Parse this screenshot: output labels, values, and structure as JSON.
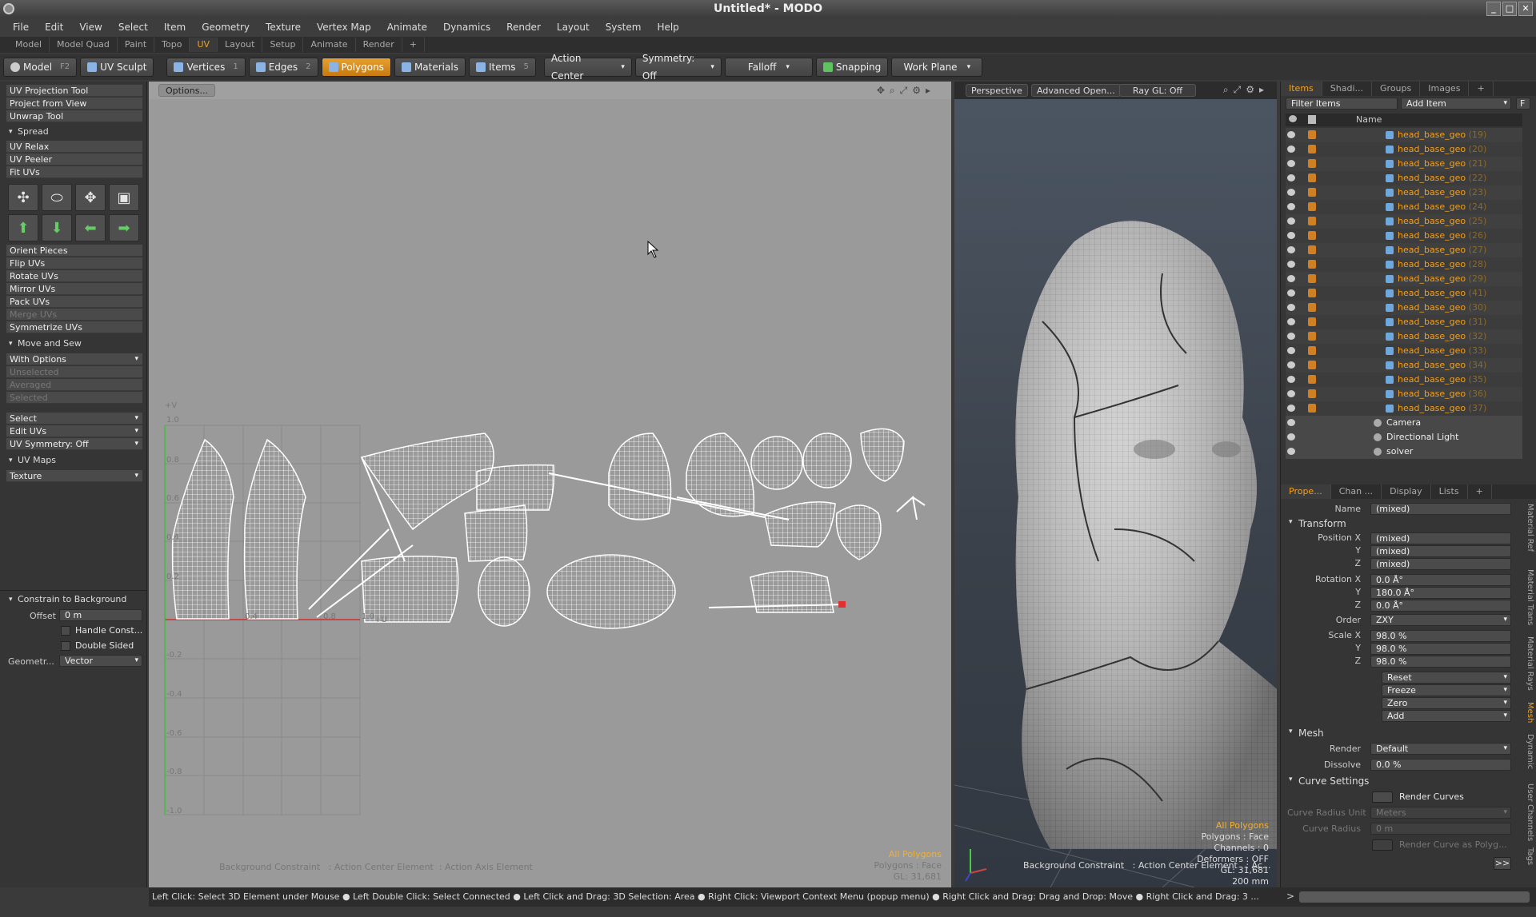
{
  "window": {
    "title": "Untitled* - MODO"
  },
  "menubar": [
    "File",
    "Edit",
    "View",
    "Select",
    "Item",
    "Geometry",
    "Texture",
    "Vertex Map",
    "Animate",
    "Dynamics",
    "Render",
    "Layout",
    "System",
    "Help"
  ],
  "layout_tabs": [
    "Model",
    "Model Quad",
    "Paint",
    "Topo",
    "UV",
    "Layout",
    "Setup",
    "Animate",
    "Render",
    "+"
  ],
  "toolbar": {
    "model": "Model",
    "model_key": "F2",
    "uv_sculpt": "UV Sculpt",
    "vertices": "Vertices",
    "vertices_key": "1",
    "edges": "Edges",
    "edges_key": "2",
    "polygons": "Polygons",
    "materials": "Materials",
    "items": "Items",
    "items_key": "5",
    "action_center": "Action Center",
    "symmetry": "Symmetry: Off",
    "falloff": "Falloff",
    "snapping": "Snapping",
    "work_plane": "Work Plane"
  },
  "left": {
    "tools1": [
      "UV Projection Tool",
      "Project from View",
      "Unwrap Tool"
    ],
    "spread": "Spread",
    "tools2": [
      "UV Relax",
      "UV Peeler",
      "Fit UVs"
    ],
    "tools3": [
      "Orient Pieces",
      "Flip UVs",
      "Rotate UVs",
      "Mirror UVs",
      "Pack UVs",
      "Merge UVs",
      "Symmetrize UVs"
    ],
    "move_sew": "Move and Sew",
    "with_options": "With Options",
    "sew_opts": [
      "Unselected",
      "Averaged",
      "Selected"
    ],
    "select": "Select",
    "edit_uvs": "Edit UVs",
    "uv_symmetry": "UV Symmetry: Off",
    "uv_maps": "UV Maps",
    "texture": "Texture",
    "constrain": "Constrain to Background",
    "offset_label": "Offset",
    "offset_value": "0 m",
    "handle_const": "Handle Const...",
    "double_sided": "Double Sided",
    "geometry_label": "Geometr...",
    "geometry_value": "Vector"
  },
  "uv_view": {
    "options": "Options...",
    "axis_v": "+V",
    "axis_u": "+U",
    "v_ticks": [
      "1.0",
      "0.8",
      "0.6",
      "0.4",
      "0.2",
      "-0.2",
      "-0.4",
      "-0.6",
      "-0.8",
      "-1.0"
    ],
    "u_ticks": [
      "0.4",
      "0.8",
      "1.0"
    ],
    "info_all": "All Polygons",
    "info_polys": "Polygons : Face",
    "info_gl": "GL: 31,681",
    "constraints": "Background Constraint   : Action Center Element  : Action Axis Element"
  },
  "view3d": {
    "perspective": "Perspective",
    "advanced": "Advanced Open...",
    "raygl": "Ray GL: Off",
    "info_all": "All Polygons",
    "info_polys": "Polygons : Face",
    "info_channels": "Channels : 0",
    "info_deformers": "Deformers : OFF",
    "info_gl": "GL: 31,681",
    "info_scale": "200 mm",
    "constraints": "Background Constraint   : Action Center Element   : Ac..."
  },
  "items_panel": {
    "tabs": [
      "Items",
      "Shadi...",
      "Groups",
      "Images",
      "+"
    ],
    "filter": "Filter Items",
    "add_item": "Add Item",
    "f": "F",
    "name_col": "Name",
    "rows": [
      {
        "name": "head_base_geo",
        "num": "(19)"
      },
      {
        "name": "head_base_geo",
        "num": "(20)"
      },
      {
        "name": "head_base_geo",
        "num": "(21)"
      },
      {
        "name": "head_base_geo",
        "num": "(22)"
      },
      {
        "name": "head_base_geo",
        "num": "(23)"
      },
      {
        "name": "head_base_geo",
        "num": "(24)"
      },
      {
        "name": "head_base_geo",
        "num": "(25)"
      },
      {
        "name": "head_base_geo",
        "num": "(26)"
      },
      {
        "name": "head_base_geo",
        "num": "(27)"
      },
      {
        "name": "head_base_geo",
        "num": "(28)"
      },
      {
        "name": "head_base_geo",
        "num": "(29)"
      },
      {
        "name": "head_base_geo",
        "num": "(41)"
      },
      {
        "name": "head_base_geo",
        "num": "(30)"
      },
      {
        "name": "head_base_geo",
        "num": "(31)"
      },
      {
        "name": "head_base_geo",
        "num": "(32)"
      },
      {
        "name": "head_base_geo",
        "num": "(33)"
      },
      {
        "name": "head_base_geo",
        "num": "(34)"
      },
      {
        "name": "head_base_geo",
        "num": "(35)"
      },
      {
        "name": "head_base_geo",
        "num": "(36)"
      },
      {
        "name": "head_base_geo",
        "num": "(37)"
      }
    ],
    "scene": [
      "Camera",
      "Directional Light",
      "solver"
    ]
  },
  "props": {
    "tabs": [
      "Prope...",
      "Chan ...",
      "Display",
      "Lists",
      "+"
    ],
    "name_label": "Name",
    "name_value": "(mixed)",
    "transform": "Transform",
    "position_x": "Position X",
    "y": "Y",
    "z": "Z",
    "pos": [
      "(mixed)",
      "(mixed)",
      "(mixed)"
    ],
    "rotation_x": "Rotation X",
    "rot": [
      "0.0 Å°",
      "180.0 Å°",
      "0.0 Å°"
    ],
    "order_label": "Order",
    "order_value": "ZXY",
    "scale_x": "Scale X",
    "scale": [
      "98.0 %",
      "98.0 %",
      "98.0 %"
    ],
    "actions": [
      "Reset",
      "Freeze",
      "Zero",
      "Add"
    ],
    "mesh": "Mesh",
    "render_label": "Render",
    "render_value": "Default",
    "dissolve_label": "Dissolve",
    "dissolve_value": "0.0 %",
    "curve_settings": "Curve Settings",
    "render_curves": "Render Curves",
    "curve_unit_label": "Curve Radius Unit",
    "curve_unit_value": "Meters",
    "curve_radius_label": "Curve Radius",
    "curve_radius_value": "0 m",
    "render_curve_poly": "Render Curve as Polyg...",
    "more": ">>",
    "side_tabs": [
      "Material Ref",
      "Material Trans",
      "Material Rays",
      "Mesh",
      "Dynamic",
      "User Channels",
      "Tags"
    ]
  },
  "status": "Left Click: Select 3D Element under Mouse ● Left Double Click: Select Connected ● Left Click and Drag: 3D Selection: Area ● Right Click: Viewport Context Menu (popup menu) ● Right Click and Drag: Drag and Drop: Move ● Right Click and Drag: 3 ...",
  "cmd_prompt": ">"
}
